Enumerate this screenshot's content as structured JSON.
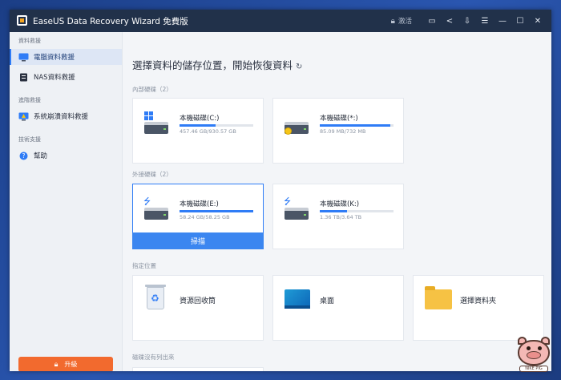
{
  "app": {
    "title": "EaseUS Data Recovery Wizard 免費版",
    "activate_label": "激活",
    "icons": [
      "lock-icon",
      "feedback-icon",
      "share-icon",
      "export-icon",
      "menu-icon",
      "minimize-icon",
      "maximize-icon",
      "close-icon"
    ]
  },
  "sidebar": {
    "sections": [
      {
        "label": "資料救援",
        "items": [
          {
            "label": "電腦資料救援",
            "icon": "monitor-icon",
            "active": true
          },
          {
            "label": "NAS資料救援",
            "icon": "nas-icon",
            "active": false
          }
        ]
      },
      {
        "label": "進階救援",
        "items": [
          {
            "label": "系統崩潰資料救援",
            "icon": "system-crash-icon",
            "active": false
          }
        ]
      },
      {
        "label": "技術支援",
        "items": [
          {
            "label": "幫助",
            "icon": "help-icon",
            "active": false
          }
        ]
      }
    ],
    "upgrade_label": "升級"
  },
  "main": {
    "title": "選擇資料的儲存位置，開始恢復資料",
    "internal_label": "內部硬碟（2）",
    "external_label": "外接硬碟（2）",
    "location_label": "指定位置",
    "missing_label": "磁碟沒有列出來",
    "scan_label": "掃描",
    "internal_drives": [
      {
        "name": "本機磁碟(C:)",
        "size": "457.46 GB/930.57 GB",
        "used_fraction": 0.49,
        "icon": "windows-drive-icon"
      },
      {
        "name": "本機磁碟(*:)",
        "size": "85.09 MB/732 MB",
        "used_fraction": 0.96,
        "icon": "locked-drive-icon"
      }
    ],
    "external_drives": [
      {
        "name": "本機磁碟(E:)",
        "size": "58.24 GB/58.25 GB",
        "used_fraction": 0.999,
        "icon": "usb-drive-icon",
        "selected": true
      },
      {
        "name": "本機磁碟(K:)",
        "size": "1.36 TB/3.64 TB",
        "used_fraction": 0.37,
        "icon": "usb-drive-icon",
        "selected": false
      }
    ],
    "locations": [
      {
        "name": "資源回收筒",
        "icon": "recycle-bin-icon"
      },
      {
        "name": "桌面",
        "icon": "desktop-icon"
      },
      {
        "name": "選擇資料夾",
        "icon": "folder-icon"
      }
    ]
  },
  "watermark": {
    "text": "NIKE PIG",
    "icon": "pig-mascot-icon"
  }
}
